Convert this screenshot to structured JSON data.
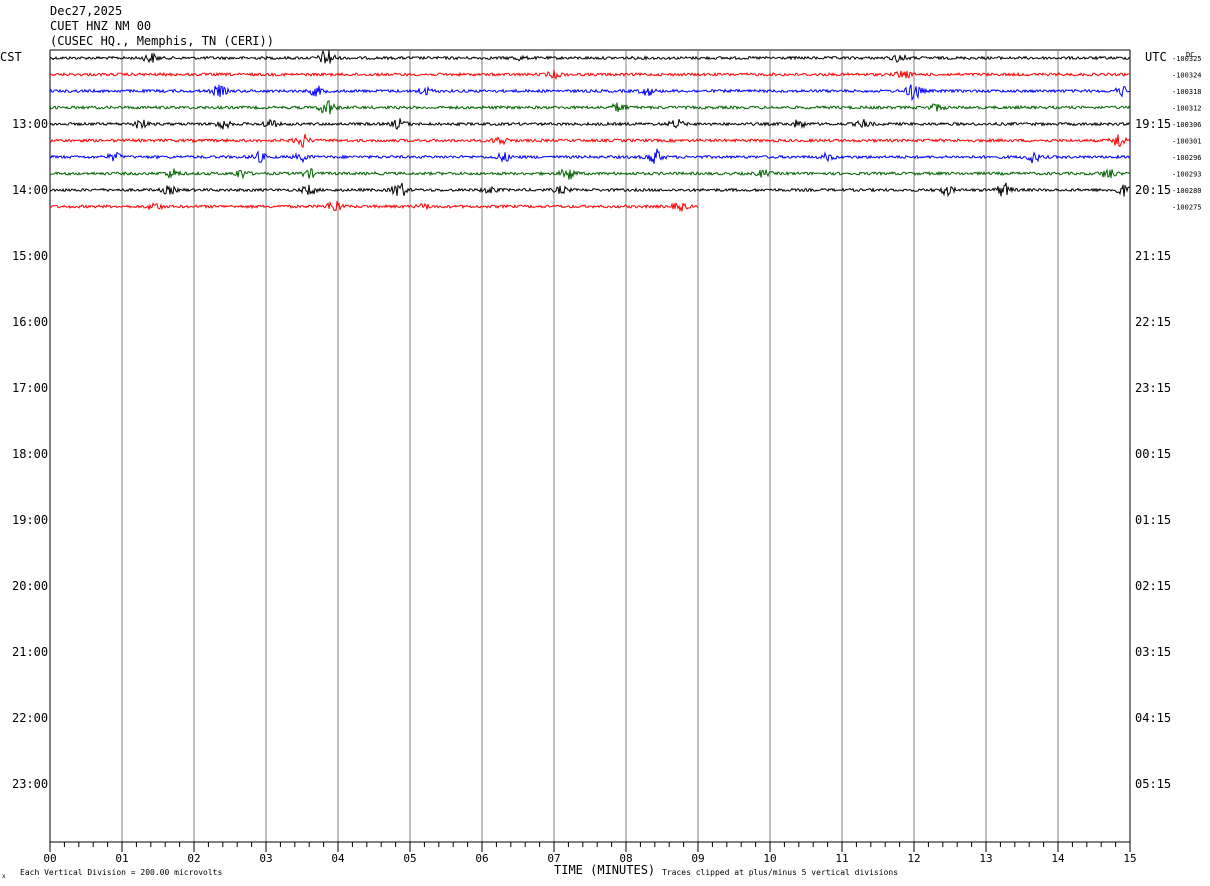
{
  "header": {
    "date": "Dec27,2025",
    "station": "CUET HNZ NM 00",
    "location": "(CUSEC HQ., Memphis, TN (CERI))"
  },
  "labels": {
    "left_zone": "CST",
    "right_zone": "UTC",
    "dc_header": "DC",
    "x_axis_title": "TIME (MINUTES)",
    "scale_note": "Each Vertical Division =  200.00 microvolts",
    "clip_note": "Traces clipped at plus/minus 5 vertical divisions",
    "corner_mark": "x"
  },
  "chart_data": {
    "type": "line",
    "title": "CUET HNZ NM 00",
    "xlabel": "TIME (MINUTES)",
    "x_ticks": [
      "00",
      "01",
      "02",
      "03",
      "04",
      "05",
      "06",
      "07",
      "08",
      "09",
      "10",
      "11",
      "12",
      "13",
      "14",
      "15"
    ],
    "xlim": [
      0,
      15
    ],
    "left_hour_labels": [
      "13:00",
      "14:00",
      "15:00",
      "16:00",
      "17:00",
      "18:00",
      "19:00",
      "20:00",
      "21:00",
      "22:00",
      "23:00"
    ],
    "right_hour_labels": [
      "19:15",
      "20:15",
      "21:15",
      "22:15",
      "23:15",
      "00:15",
      "01:15",
      "02:15",
      "03:15",
      "04:15",
      "05:15"
    ],
    "rows_per_hour": 4,
    "total_rows": 48,
    "trace_colors": [
      "#000000",
      "#ff0000",
      "#0000ff",
      "#006400"
    ],
    "traces": [
      {
        "row": 0,
        "color": "#000000",
        "dc": "-100325",
        "end_minute": 15,
        "events": [
          [
            1.4,
            0.5
          ],
          [
            3.85,
            1.0
          ],
          [
            11.8,
            0.4
          ],
          [
            6.5,
            0.2
          ]
        ]
      },
      {
        "row": 1,
        "color": "#ff0000",
        "dc": "-100324",
        "end_minute": 15,
        "events": [
          [
            7.0,
            0.35
          ],
          [
            11.85,
            0.45
          ]
        ]
      },
      {
        "row": 2,
        "color": "#0000ff",
        "dc": "-100318",
        "end_minute": 15,
        "events": [
          [
            2.35,
            0.6
          ],
          [
            3.7,
            0.5
          ],
          [
            5.2,
            0.4
          ],
          [
            8.3,
            0.45
          ],
          [
            12.0,
            1.0
          ],
          [
            14.9,
            0.5
          ]
        ]
      },
      {
        "row": 3,
        "color": "#006400",
        "dc": "-100312",
        "end_minute": 15,
        "events": [
          [
            3.85,
            0.9
          ],
          [
            7.9,
            0.5
          ],
          [
            12.3,
            0.35
          ]
        ]
      },
      {
        "row": 4,
        "color": "#000000",
        "dc": "-100306",
        "end_minute": 15,
        "events": [
          [
            1.25,
            0.5
          ],
          [
            2.4,
            0.5
          ],
          [
            3.05,
            0.45
          ],
          [
            4.85,
            0.55
          ],
          [
            8.7,
            0.45
          ],
          [
            10.4,
            0.4
          ],
          [
            11.3,
            0.4
          ]
        ]
      },
      {
        "row": 5,
        "color": "#ff0000",
        "dc": "-100301",
        "end_minute": 15,
        "events": [
          [
            3.5,
            0.7
          ],
          [
            6.25,
            0.45
          ],
          [
            14.85,
            0.8
          ]
        ]
      },
      {
        "row": 6,
        "color": "#0000ff",
        "dc": "-100296",
        "end_minute": 15,
        "events": [
          [
            0.9,
            0.4
          ],
          [
            2.9,
            0.5
          ],
          [
            3.5,
            0.4
          ],
          [
            6.3,
            0.45
          ],
          [
            8.4,
            0.9
          ],
          [
            10.8,
            0.35
          ],
          [
            13.65,
            0.55
          ]
        ]
      },
      {
        "row": 7,
        "color": "#006400",
        "dc": "-100293",
        "end_minute": 15,
        "events": [
          [
            1.7,
            0.5
          ],
          [
            2.65,
            0.45
          ],
          [
            3.6,
            0.45
          ],
          [
            7.2,
            0.7
          ],
          [
            9.9,
            0.35
          ],
          [
            14.7,
            0.55
          ]
        ]
      },
      {
        "row": 8,
        "color": "#000000",
        "dc": "-100280",
        "end_minute": 15,
        "events": [
          [
            1.65,
            0.4
          ],
          [
            3.6,
            0.5
          ],
          [
            4.85,
            0.9
          ],
          [
            6.1,
            0.35
          ],
          [
            7.1,
            0.35
          ],
          [
            12.45,
            0.5
          ],
          [
            13.25,
            0.75
          ],
          [
            14.9,
            0.6
          ]
        ]
      },
      {
        "row": 9,
        "color": "#ff0000",
        "dc": "-100275",
        "end_minute": 9,
        "events": [
          [
            1.45,
            0.4
          ],
          [
            3.95,
            0.7
          ],
          [
            5.2,
            0.25
          ],
          [
            8.75,
            0.45
          ]
        ]
      }
    ]
  }
}
